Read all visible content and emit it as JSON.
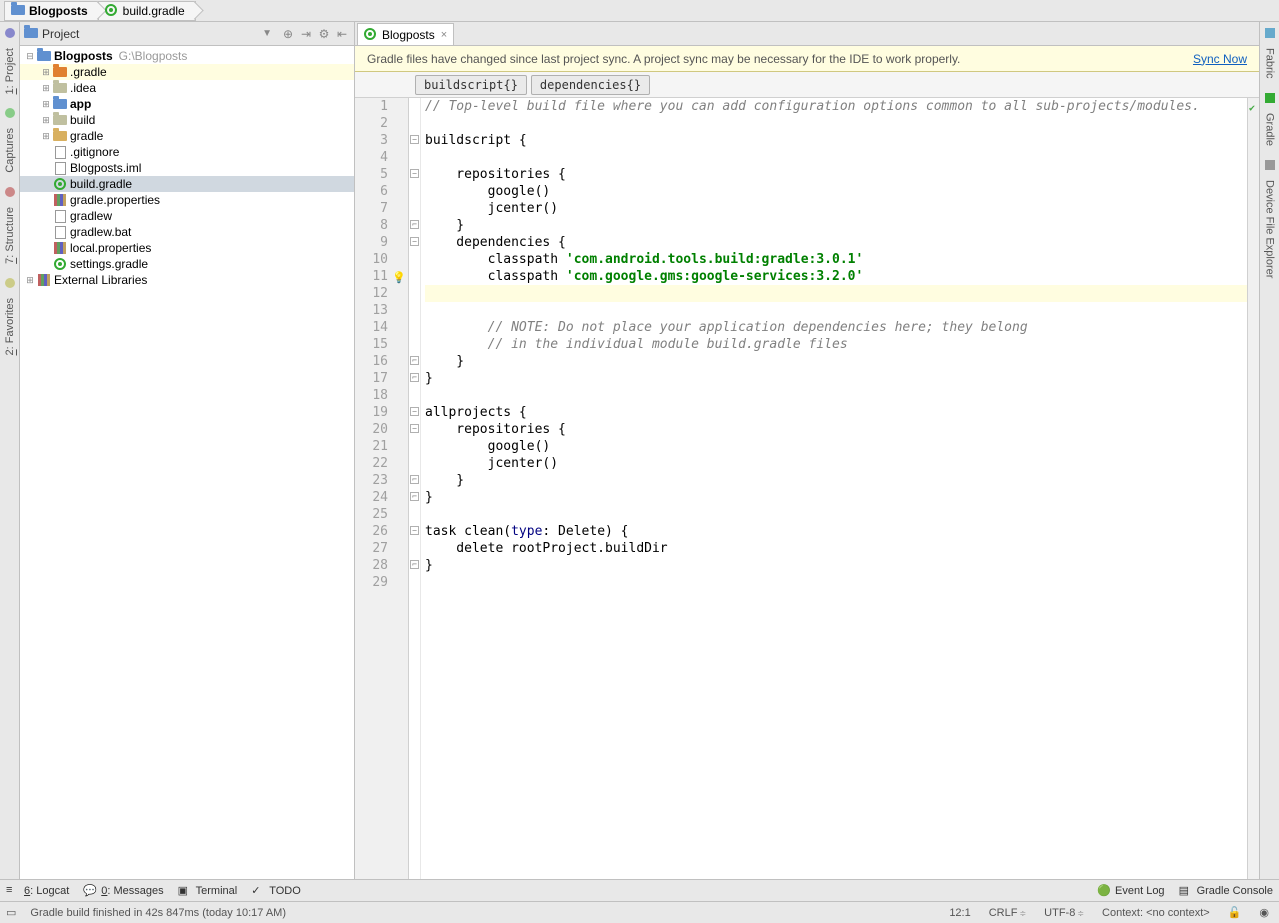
{
  "breadcrumb": [
    {
      "label": "Blogposts",
      "bold": true,
      "icon": "folder-blue"
    },
    {
      "label": "build.gradle",
      "bold": false,
      "icon": "gradle"
    }
  ],
  "leftrail": [
    {
      "label": "1: Project",
      "underline_index": 0
    },
    {
      "label": "Captures"
    },
    {
      "label": "7: Structure",
      "underline_index": 0
    },
    {
      "label": "2: Favorites",
      "underline_index": 0
    }
  ],
  "rightrail": [
    {
      "label": "Fabric"
    },
    {
      "label": "Gradle"
    },
    {
      "label": "Device File Explorer"
    }
  ],
  "project_panel": {
    "title": "Project",
    "items": [
      {
        "depth": 0,
        "exp": "-",
        "icon": "folder-blue",
        "label": "Blogposts",
        "bold": true,
        "path": "G:\\Blogposts"
      },
      {
        "depth": 1,
        "exp": "+",
        "icon": "folder-orange",
        "label": ".gradle",
        "hl": true
      },
      {
        "depth": 1,
        "exp": "+",
        "icon": "folder-dim",
        "label": ".idea"
      },
      {
        "depth": 1,
        "exp": "+",
        "icon": "folder-blue",
        "label": "app",
        "bold": true
      },
      {
        "depth": 1,
        "exp": "+",
        "icon": "folder-dim",
        "label": "build"
      },
      {
        "depth": 1,
        "exp": "+",
        "icon": "folder",
        "label": "gradle"
      },
      {
        "depth": 1,
        "exp": "",
        "icon": "file",
        "label": ".gitignore"
      },
      {
        "depth": 1,
        "exp": "",
        "icon": "file",
        "label": "Blogposts.iml"
      },
      {
        "depth": 1,
        "exp": "",
        "icon": "gradle",
        "label": "build.gradle",
        "selected": true
      },
      {
        "depth": 1,
        "exp": "",
        "icon": "lib",
        "label": "gradle.properties"
      },
      {
        "depth": 1,
        "exp": "",
        "icon": "file",
        "label": "gradlew"
      },
      {
        "depth": 1,
        "exp": "",
        "icon": "file",
        "label": "gradlew.bat"
      },
      {
        "depth": 1,
        "exp": "",
        "icon": "lib",
        "label": "local.properties"
      },
      {
        "depth": 1,
        "exp": "",
        "icon": "gradle",
        "label": "settings.gradle"
      },
      {
        "depth": 0,
        "exp": "+",
        "icon": "lib",
        "label": "External Libraries"
      }
    ]
  },
  "editor": {
    "tab_label": "Blogposts",
    "notice": "Gradle files have changed since last project sync. A project sync may be necessary for the IDE to work properly.",
    "notice_link": "Sync Now",
    "crumbs": [
      "buildscript{}",
      "dependencies{}"
    ],
    "lines": [
      {
        "n": 1,
        "t": "comment",
        "text": "// Top-level build file where you can add configuration options common to all sub-projects/modules."
      },
      {
        "n": 2,
        "t": "plain",
        "text": ""
      },
      {
        "n": 3,
        "t": "plain",
        "text": "buildscript {",
        "fold": "-"
      },
      {
        "n": 4,
        "t": "plain",
        "text": ""
      },
      {
        "n": 5,
        "t": "plain",
        "text": "    repositories {",
        "fold": "-"
      },
      {
        "n": 6,
        "t": "plain",
        "text": "        google()"
      },
      {
        "n": 7,
        "t": "plain",
        "text": "        jcenter()"
      },
      {
        "n": 8,
        "t": "plain",
        "text": "    }",
        "fold": "e"
      },
      {
        "n": 9,
        "t": "plain",
        "text": "    dependencies {",
        "fold": "-"
      },
      {
        "n": 10,
        "t": "dep",
        "pre": "        classpath ",
        "str": "'com.android.tools.build:gradle:3.0.1'"
      },
      {
        "n": 11,
        "t": "dep",
        "pre": "        classpath ",
        "str": "'com.google.gms:google-services:3.2.0'",
        "bulb": true
      },
      {
        "n": 12,
        "t": "plain",
        "text": "",
        "cur": true
      },
      {
        "n": 13,
        "t": "plain",
        "text": ""
      },
      {
        "n": 14,
        "t": "comment",
        "text": "        // NOTE: Do not place your application dependencies here; they belong"
      },
      {
        "n": 15,
        "t": "comment",
        "text": "        // in the individual module build.gradle files"
      },
      {
        "n": 16,
        "t": "plain",
        "text": "    }",
        "fold": "e"
      },
      {
        "n": 17,
        "t": "plain",
        "text": "}",
        "fold": "e"
      },
      {
        "n": 18,
        "t": "plain",
        "text": ""
      },
      {
        "n": 19,
        "t": "plain",
        "text": "allprojects {",
        "fold": "-"
      },
      {
        "n": 20,
        "t": "plain",
        "text": "    repositories {",
        "fold": "-"
      },
      {
        "n": 21,
        "t": "plain",
        "text": "        google()"
      },
      {
        "n": 22,
        "t": "plain",
        "text": "        jcenter()"
      },
      {
        "n": 23,
        "t": "plain",
        "text": "    }",
        "fold": "e"
      },
      {
        "n": 24,
        "t": "plain",
        "text": "}",
        "fold": "e"
      },
      {
        "n": 25,
        "t": "plain",
        "text": ""
      },
      {
        "n": 26,
        "t": "task",
        "pre": "task clean(",
        "kw": "type",
        "post": ": Delete) {",
        "fold": "-"
      },
      {
        "n": 27,
        "t": "plain",
        "text": "    delete rootProject.buildDir"
      },
      {
        "n": 28,
        "t": "plain",
        "text": "}",
        "fold": "e"
      },
      {
        "n": 29,
        "t": "plain",
        "text": ""
      }
    ]
  },
  "bottom_tabs": {
    "left": [
      "6: Logcat",
      "0: Messages",
      "Terminal",
      "TODO"
    ],
    "right": [
      "Event Log",
      "Gradle Console"
    ]
  },
  "status": {
    "msg": "Gradle build finished in 42s 847ms (today 10:17 AM)",
    "pos": "12:1",
    "eol": "CRLF",
    "enc": "UTF-8",
    "ctx": "Context: <no context>"
  }
}
